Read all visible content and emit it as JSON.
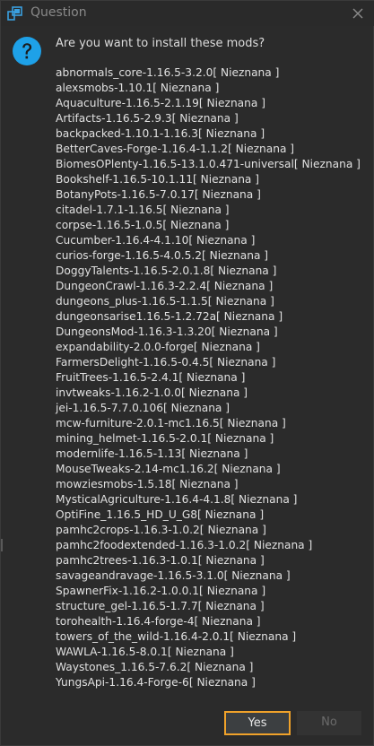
{
  "window": {
    "title": "Question",
    "close_icon": "close-icon",
    "app_icon": "app-icon"
  },
  "dialog": {
    "icon": "question-icon",
    "prompt": "Are you want to install these mods?",
    "mods": [
      "abnormals_core-1.16.5-3.2.0[ Nieznana ]",
      "alexsmobs-1.10.1[ Nieznana ]",
      "Aquaculture-1.16.5-2.1.19[ Nieznana ]",
      "Artifacts-1.16.5-2.9.3[ Nieznana ]",
      "backpacked-1.10.1-1.16.3[ Nieznana ]",
      "BetterCaves-Forge-1.16.4-1.1.2[ Nieznana ]",
      "BiomesOPlenty-1.16.5-13.1.0.471-universal[ Nieznana ]",
      "Bookshelf-1.16.5-10.1.11[ Nieznana ]",
      "BotanyPots-1.16.5-7.0.17[ Nieznana ]",
      "citadel-1.7.1-1.16.5[ Nieznana ]",
      "corpse-1.16.5-1.0.5[ Nieznana ]",
      "Cucumber-1.16.4-4.1.10[ Nieznana ]",
      "curios-forge-1.16.5-4.0.5.2[ Nieznana ]",
      "DoggyTalents-1.16.5-2.0.1.8[ Nieznana ]",
      "DungeonCrawl-1.16.3-2.2.4[ Nieznana ]",
      "dungeons_plus-1.16.5-1.1.5[ Nieznana ]",
      "dungeonsarise1.16.5-1.2.72a[ Nieznana ]",
      "DungeonsMod-1.16.3-1.3.20[ Nieznana ]",
      "expandability-2.0.0-forge[ Nieznana ]",
      "FarmersDelight-1.16.5-0.4.5[ Nieznana ]",
      "FruitTrees-1.16.5-2.4.1[ Nieznana ]",
      "invtweaks-1.16.2-1.0.0[ Nieznana ]",
      "jei-1.16.5-7.7.0.106[ Nieznana ]",
      "mcw-furniture-2.0.1-mc1.16.5[ Nieznana ]",
      "mining_helmet-1.16.5-2.0.1[ Nieznana ]",
      "modernlife-1.16.5-1.13[ Nieznana ]",
      "MouseTweaks-2.14-mc1.16.2[ Nieznana ]",
      "mowziesmobs-1.5.18[ Nieznana ]",
      "MysticalAgriculture-1.16.4-4.1.8[ Nieznana ]",
      "OptiFine_1.16.5_HD_U_G8[ Nieznana ]",
      "pamhc2crops-1.16.3-1.0.2[ Nieznana ]",
      "pamhc2foodextended-1.16.3-1.0.2[ Nieznana ]",
      "pamhc2trees-1.16.3-1.0.1[ Nieznana ]",
      "savageandravage-1.16.5-3.1.0[ Nieznana ]",
      "SpawnerFix-1.16.2-1.0.0.1[ Nieznana ]",
      "structure_gel-1.16.5-1.7.7[ Nieznana ]",
      "torohealth-1.16.4-forge-4[ Nieznana ]",
      "towers_of_the_wild-1.16.4-2.0.1[ Nieznana ]",
      "WAWLA-1.16.5-8.0.1[ Nieznana ]",
      "Waystones_1.16.5-7.6.2[ Nieznana ]",
      "YungsApi-1.16.4-Forge-6[ Nieznana ]"
    ]
  },
  "buttons": {
    "yes_label": "Yes",
    "no_label": "No"
  },
  "colors": {
    "background": "#2b2b2b",
    "text": "#e0e0e0",
    "accent_focus": "#f0a22a",
    "question_icon": "#1ea1e8",
    "disabled_text": "#6b6b6b"
  }
}
